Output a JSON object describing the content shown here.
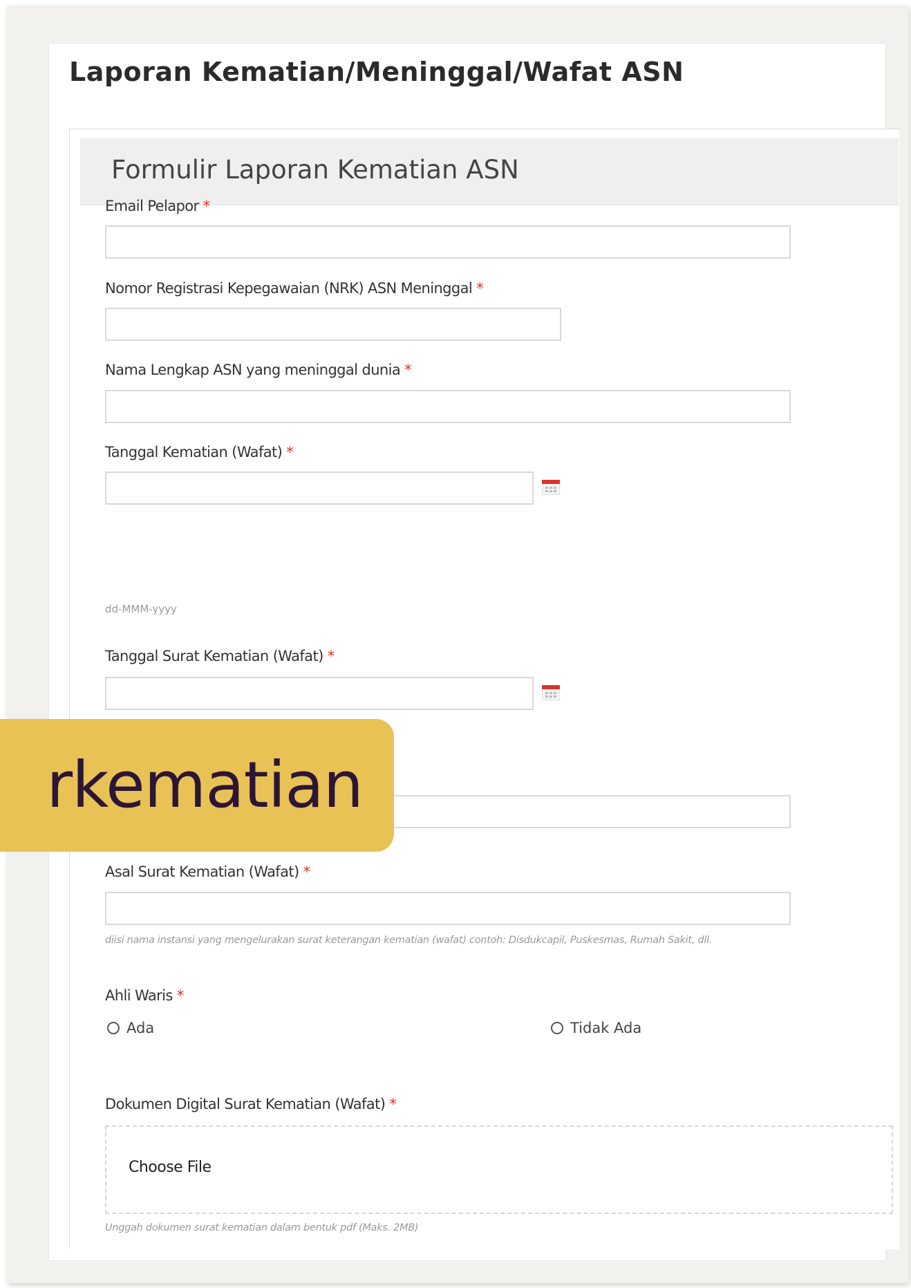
{
  "page": {
    "title": "Laporan Kematian/Meninggal/Wafat ASN"
  },
  "form": {
    "title": "Formulir Laporan Kematian ASN",
    "required_marker": "*",
    "fields": {
      "email": {
        "label": "Email Pelapor",
        "value": "",
        "placeholder": ""
      },
      "nrk": {
        "label": "Nomor Registrasi Kepegawaian (NRK) ASN Meninggal",
        "value": "",
        "placeholder": ""
      },
      "nama": {
        "label": "Nama Lengkap ASN yang meninggal dunia",
        "value": "",
        "placeholder": ""
      },
      "tanggal_kematian": {
        "label": "Tanggal Kematian (Wafat)",
        "value": "",
        "hint": "dd-MMM-yyyy"
      },
      "tanggal_surat": {
        "label": "Tanggal Surat Kematian (Wafat)",
        "value": ""
      },
      "nomor_surat": {
        "value": ""
      },
      "asal_surat": {
        "label": "Asal Surat Kematian (Wafat)",
        "value": "",
        "hint": "diisi nama instansi yang mengelurakan surat keterangan kematian (wafat) contoh: Disdukcapil, Puskesmas, Rumah Sakit, dll."
      },
      "ahli_waris": {
        "label": "Ahli Waris",
        "options": [
          "Ada",
          "Tidak Ada"
        ]
      },
      "dokumen": {
        "label": "Dokumen Digital Surat Kematian (Wafat)",
        "button": "Choose File",
        "hint": "Unggah dokumen surat kematian dalam bentuk pdf (Maks. 2MB)"
      }
    }
  },
  "overlay": {
    "text": "rkematian"
  },
  "colors": {
    "required": "#d9342b",
    "overlay_bg": "#e9c255",
    "overlay_text": "#2d1536",
    "calendar_icon": "#d9342b"
  },
  "icons": [
    "calendar-icon",
    "radio-button-icon"
  ]
}
